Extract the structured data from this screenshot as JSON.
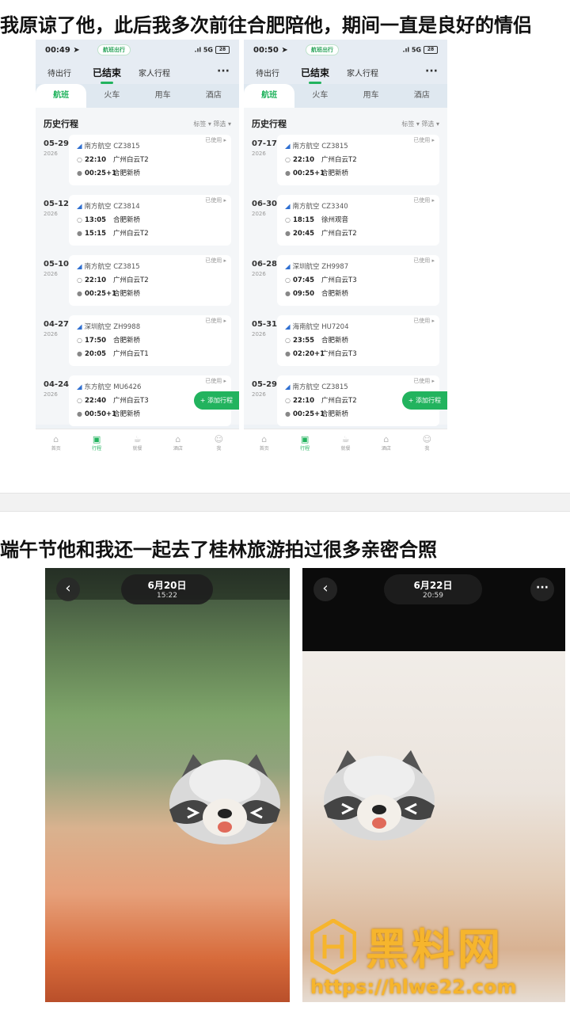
{
  "caption_top": "我原谅了他，此后我多次前往合肥陪他，期间一直是良好的情侣",
  "caption_mid": "端午节他和我还一起去了桂林旅游拍过很多亲密合照",
  "phones": [
    {
      "status_time": "00:49",
      "status_pill": "航班出行",
      "status_net": "5G",
      "battery": "28",
      "top_tabs": [
        "待出行",
        "已结束",
        "家人行程"
      ],
      "active_top_tab": 1,
      "more": "···",
      "categories": [
        "航班",
        "火车",
        "用车",
        "酒店"
      ],
      "history_title": "历史行程",
      "filter_tag": "标签 ▾",
      "filter_sort": "筛选 ▾",
      "trips": [
        {
          "date": "05-29",
          "year": "2026",
          "airline": "南方航空",
          "flight": "CZ3815",
          "status": "已使用 ▸",
          "dep_time": "22:10",
          "dep_place": "广州白云T2",
          "arr_time": "00:25",
          "arr_suffix": "+1",
          "arr_place": "合肥新桥"
        },
        {
          "date": "05-12",
          "year": "2026",
          "airline": "南方航空",
          "flight": "CZ3814",
          "status": "已使用 ▸",
          "dep_time": "13:05",
          "dep_place": "合肥新桥",
          "arr_time": "15:15",
          "arr_suffix": "",
          "arr_place": "广州白云T2"
        },
        {
          "date": "05-10",
          "year": "2026",
          "airline": "南方航空",
          "flight": "CZ3815",
          "status": "已使用 ▸",
          "dep_time": "22:10",
          "dep_place": "广州白云T2",
          "arr_time": "00:25",
          "arr_suffix": "+1",
          "arr_place": "合肥新桥"
        },
        {
          "date": "04-27",
          "year": "2026",
          "airline": "深圳航空",
          "flight": "ZH9988",
          "status": "已使用 ▸",
          "dep_time": "17:50",
          "dep_place": "合肥新桥",
          "arr_time": "20:05",
          "arr_suffix": "",
          "arr_place": "广州白云T1"
        },
        {
          "date": "04-24",
          "year": "2026",
          "airline": "东方航空",
          "flight": "MU6426",
          "status": "已使用 ▸",
          "dep_time": "22:40",
          "dep_place": "广州白云T3",
          "arr_time": "00:50",
          "arr_suffix": "+1",
          "arr_place": "合肥新桥"
        }
      ],
      "add_button": "+ 添加行程",
      "nav": [
        "首页",
        "行程",
        "就餐",
        "酒店",
        "我"
      ],
      "active_nav": 1
    },
    {
      "status_time": "00:50",
      "status_pill": "航班出行",
      "status_net": "5G",
      "battery": "28",
      "top_tabs": [
        "待出行",
        "已结束",
        "家人行程"
      ],
      "active_top_tab": 1,
      "more": "···",
      "categories": [
        "航班",
        "火车",
        "用车",
        "酒店"
      ],
      "history_title": "历史行程",
      "filter_tag": "标签 ▾",
      "filter_sort": "筛选 ▾",
      "trips": [
        {
          "date": "07-17",
          "year": "2026",
          "airline": "南方航空",
          "flight": "CZ3815",
          "status": "已使用 ▸",
          "dep_time": "22:10",
          "dep_place": "广州白云T2",
          "arr_time": "00:25",
          "arr_suffix": "+1",
          "arr_place": "合肥新桥"
        },
        {
          "date": "06-30",
          "year": "2026",
          "airline": "南方航空",
          "flight": "CZ3340",
          "status": "已使用 ▸",
          "dep_time": "18:15",
          "dep_place": "徐州观音",
          "arr_time": "20:45",
          "arr_suffix": "",
          "arr_place": "广州白云T2"
        },
        {
          "date": "06-28",
          "year": "2026",
          "airline": "深圳航空",
          "flight": "ZH9987",
          "status": "已使用 ▸",
          "dep_time": "07:45",
          "dep_place": "广州白云T3",
          "arr_time": "09:50",
          "arr_suffix": "",
          "arr_place": "合肥新桥"
        },
        {
          "date": "05-31",
          "year": "2026",
          "airline": "海南航空",
          "flight": "HU7204",
          "status": "已使用 ▸",
          "dep_time": "23:55",
          "dep_place": "合肥新桥",
          "arr_time": "02:20",
          "arr_suffix": "+1",
          "arr_place": "广州白云T3"
        },
        {
          "date": "05-29",
          "year": "2026",
          "airline": "南方航空",
          "flight": "CZ3815",
          "status": "已使用 ▸",
          "dep_time": "22:10",
          "dep_place": "广州白云T2",
          "arr_time": "00:25",
          "arr_suffix": "+1",
          "arr_place": "合肥新桥"
        }
      ],
      "add_button": "+ 添加行程",
      "nav": [
        "首页",
        "行程",
        "就餐",
        "酒店",
        "我"
      ],
      "active_nav": 1
    }
  ],
  "photos": [
    {
      "date": "6月20日",
      "time": "15:22",
      "back": "‹"
    },
    {
      "date": "6月22日",
      "time": "20:59",
      "back": "‹",
      "more": "···"
    }
  ],
  "watermark": {
    "title": "黑料网",
    "url": "https://hlwe22.com"
  },
  "colors": {
    "accent": "#22b35e",
    "airline_blue": "#2f6fd1",
    "watermark": "#f6b52d"
  }
}
